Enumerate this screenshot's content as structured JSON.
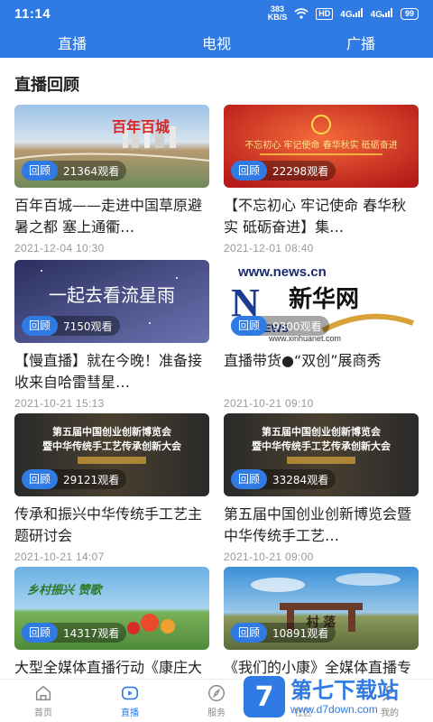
{
  "status_bar": {
    "time": "11:14",
    "net_speed_value": "383",
    "net_speed_unit": "KB/S",
    "hd_label": "HD",
    "signal_1": "4G",
    "signal_2": "4G",
    "battery": "99"
  },
  "top_tabs": [
    "直播",
    "电视",
    "广播"
  ],
  "section_title": "直播回顾",
  "badge_label": "回顾",
  "cards": [
    {
      "views": "21364观看",
      "title": "百年百城——走进中国草原避暑之都 塞上通衢…",
      "date": "2021-12-04 10:30",
      "thumb": "city-aerial",
      "colors": [
        "#8fb3d9",
        "#c9a27a"
      ]
    },
    {
      "views": "22298观看",
      "title": "【不忘初心 牢记使命 春华秋实 砥砺奋进】集…",
      "date": "2021-12-01 08:40",
      "thumb": "red-banner",
      "colors": [
        "#c8231f",
        "#f26a3a"
      ]
    },
    {
      "views": "7150观看",
      "title": "【慢直播】就在今晚！准备接收来自哈雷彗星…",
      "date": "2021-10-21 15:13",
      "thumb": "night-sky",
      "colors": [
        "#2a2f5c",
        "#5a6aa8"
      ]
    },
    {
      "views": "9300观看",
      "title": "直播带货●“双创”展商秀",
      "date": "2021-10-21 09:10",
      "thumb": "xinhua-logo",
      "colors": [
        "#ffffff",
        "#1a3b8f"
      ]
    },
    {
      "views": "29121观看",
      "title": "传承和振兴中华传统手工艺主题研讨会",
      "date": "2021-10-21 14:07",
      "thumb": "expo-banner",
      "colors": [
        "#2b2b2b",
        "#6b5a3a"
      ]
    },
    {
      "views": "33284观看",
      "title": "第五届中国创业创新博览会暨中华传统手工艺…",
      "date": "2021-10-21 09:00",
      "thumb": "expo-banner",
      "colors": [
        "#2b2b2b",
        "#6b5a3a"
      ]
    },
    {
      "views": "14317观看",
      "title": "大型全媒体直播行动《康庄大道》自治区专…",
      "date": "",
      "thumb": "harvest-scene",
      "colors": [
        "#5da6dc",
        "#6aa34a"
      ]
    },
    {
      "views": "10891观看",
      "title": "《我们的小康》全媒体直播专辑篇",
      "date": "",
      "thumb": "village-gate",
      "colors": [
        "#3d8ed6",
        "#8a9a5a"
      ]
    }
  ],
  "thumb_texts": {
    "card1": "百年百城",
    "card2": "不忘初心 牢记使命 春华秋实 砥砺奋进",
    "card3": "一起去看流星雨",
    "card4_url": "www.news.cn",
    "card4_brand": "新华网",
    "card4_news": "NEWS",
    "card4_site": "www.xinhuanet.com",
    "expo_title": "第五届中国创业创新博览会",
    "expo_subtitle": "暨中华传统手工艺传承创新大会",
    "card7_text": "乡村振兴 赞歌",
    "card8_text": "村 落"
  },
  "bottom_nav": [
    {
      "label": "首页",
      "icon": "home-icon",
      "active": false
    },
    {
      "label": "直播",
      "icon": "tv-icon",
      "active": true
    },
    {
      "label": "服务",
      "icon": "compass-icon",
      "active": false
    },
    {
      "label": "社区",
      "icon": "community-icon",
      "active": false
    },
    {
      "label": "我的",
      "icon": "profile-icon",
      "active": false
    }
  ],
  "watermark": {
    "logo": "7",
    "name": "第七下载站",
    "url": "www.d7down.com"
  },
  "colors": {
    "primary": "#2f7be3",
    "date_gray": "#999999",
    "text": "#222222"
  }
}
